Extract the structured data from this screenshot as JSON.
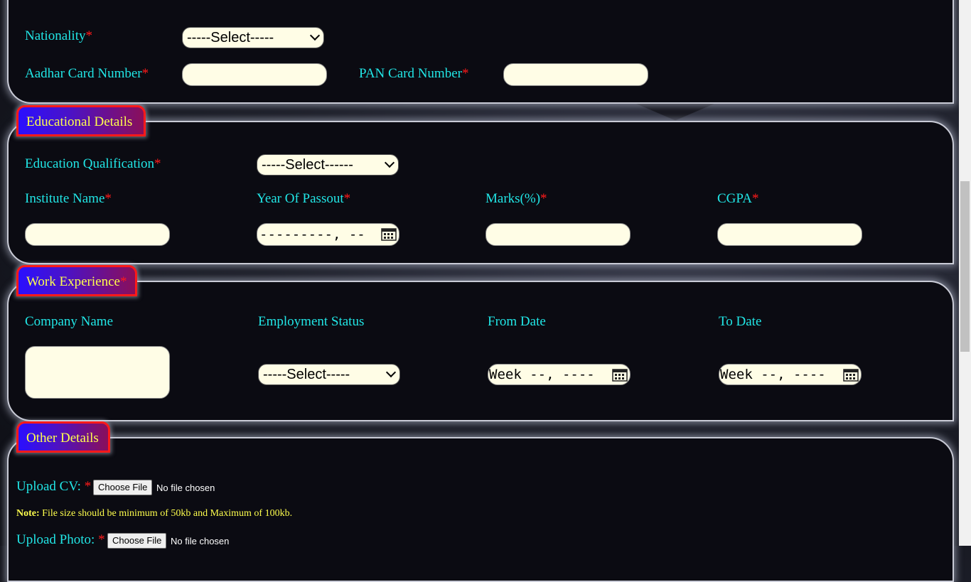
{
  "personal": {
    "nationality_label": "Nationality",
    "nationality_select": "-----Select-----",
    "aadhar_label": "Aadhar Card Number",
    "aadhar_value": "",
    "pan_label": "PAN Card Number",
    "pan_value": "",
    "required_mark": "*"
  },
  "education": {
    "section_title": "Educational Details",
    "qualification_label": "Education Qualification",
    "qualification_select": "-----Select------",
    "institute_label": "Institute Name",
    "year_label": "Year Of Passout",
    "year_value": "---------, --",
    "marks_label": "Marks(%)",
    "cgpa_label": "CGPA"
  },
  "work": {
    "section_title": "Work Experience",
    "company_label": "Company Name",
    "status_label": "Employment Status",
    "status_select": "-----Select-----",
    "from_label": "From Date",
    "from_value": "Week --, ----",
    "to_label": "To Date",
    "to_value": "Week --, ----"
  },
  "other": {
    "section_title": "Other Details",
    "cv_label": "Upload CV:",
    "choose_file": "Choose File",
    "no_file": "No file chosen",
    "note_label": "Note:",
    "note_text": "File size should be minimum of 50kb and Maximum of 100kb.",
    "photo_label": "Upload Photo:"
  },
  "colors": {
    "label": "#21e6e6",
    "required": "#ff1a1a",
    "input_bg": "#fffde6",
    "tag_text": "#ffff4d"
  }
}
